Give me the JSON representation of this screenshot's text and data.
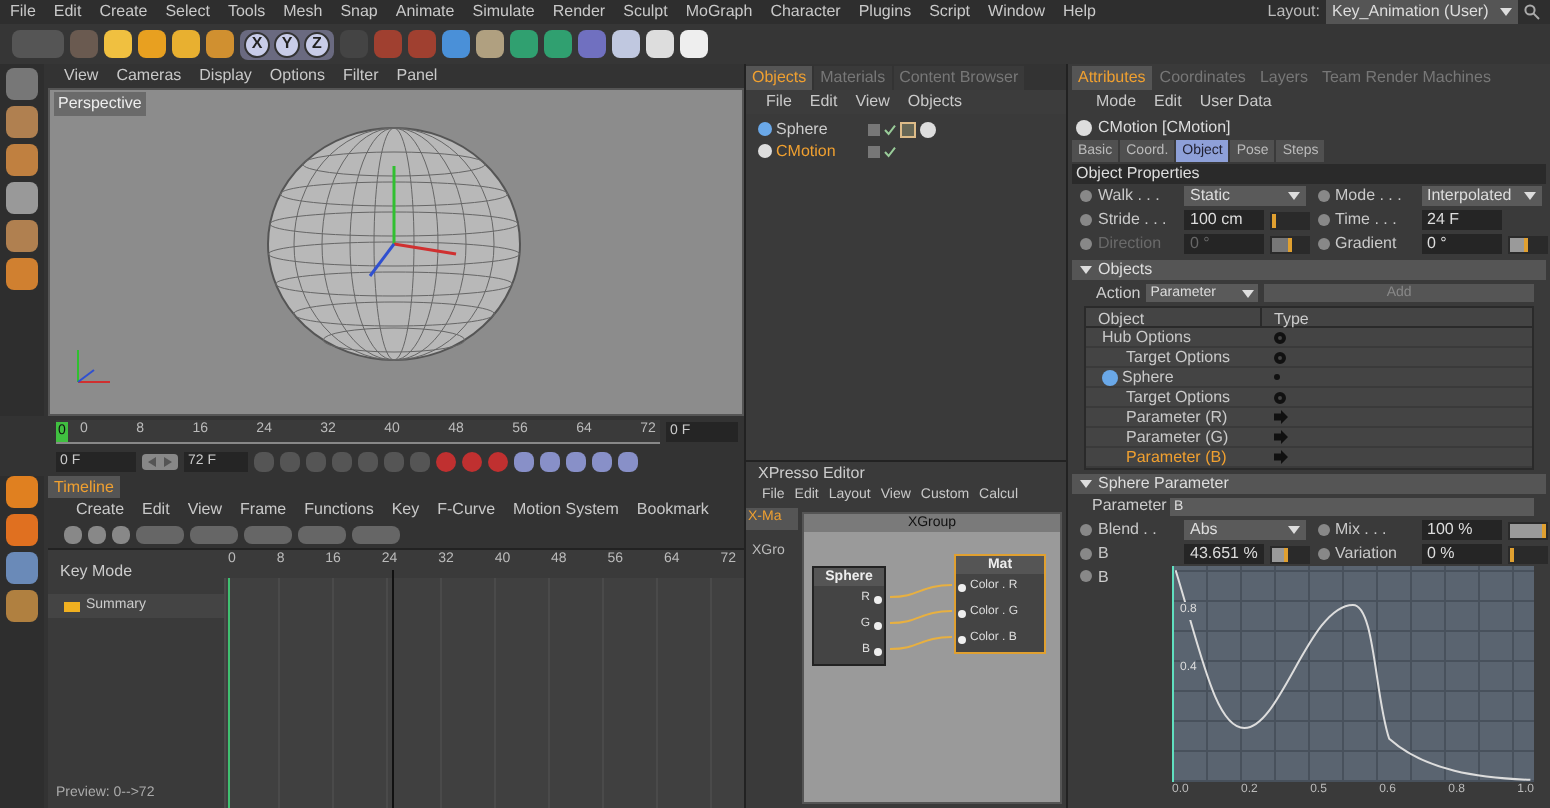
{
  "menu_bar": {
    "items": [
      "File",
      "Edit",
      "Create",
      "Select",
      "Tools",
      "Mesh",
      "Snap",
      "Animate",
      "Simulate",
      "Render",
      "Sculpt",
      "MoGraph",
      "Character",
      "Plugins",
      "Script",
      "Window",
      "Help"
    ],
    "layout_label": "Layout:",
    "layout_value": "Key_Animation (User)"
  },
  "toolbar": {
    "axis_buttons": [
      "X",
      "Y",
      "Z"
    ]
  },
  "viewport": {
    "menu": [
      "View",
      "Cameras",
      "Display",
      "Options",
      "Filter",
      "Panel"
    ],
    "camera_label": "Perspective"
  },
  "frame_ruler": {
    "ticks": [
      "0",
      "8",
      "16",
      "24",
      "32",
      "40",
      "48",
      "56",
      "64",
      "72"
    ],
    "playhead": "0",
    "current_frame": "0 F"
  },
  "transport": {
    "start": "0 F",
    "end": "72 F"
  },
  "timeline": {
    "tab": "Timeline",
    "menu": [
      "Create",
      "Edit",
      "View",
      "Frame",
      "Functions",
      "Key",
      "F-Curve",
      "Motion System",
      "Bookmark"
    ],
    "ticks": [
      "0",
      "8",
      "16",
      "24",
      "32",
      "40",
      "48",
      "56",
      "64",
      "72"
    ],
    "header": "Key Mode",
    "tracks": [
      {
        "name": "Summary",
        "selected": false
      }
    ],
    "status": "Preview: 0-->72"
  },
  "objects_panel": {
    "tabs": [
      {
        "label": "Objects",
        "selected": true
      },
      {
        "label": "Materials",
        "selected": false
      },
      {
        "label": "Content Browser",
        "selected": false
      }
    ],
    "menu": [
      "File",
      "Edit",
      "View",
      "Objects"
    ],
    "items": [
      {
        "name": "Sphere",
        "selected": false
      },
      {
        "name": "CMotion",
        "selected": true
      }
    ]
  },
  "xpresso": {
    "title": "XPresso Editor",
    "menu": [
      "File",
      "Edit",
      "Layout",
      "View",
      "Custom",
      "Calcul"
    ],
    "side_tab": "X-Ma",
    "tree_item": "XGro",
    "group": "XGroup",
    "nodes": [
      {
        "title": "Sphere",
        "ports": [
          "R",
          "G",
          "B"
        ]
      },
      {
        "title": "Mat",
        "ports": [
          "Color . R",
          "Color . G",
          "Color . B"
        ]
      }
    ]
  },
  "attributes": {
    "tabs": [
      {
        "label": "Attributes",
        "selected": true
      },
      {
        "label": "Coordinates",
        "selected": false
      },
      {
        "label": "Layers",
        "selected": false
      },
      {
        "label": "Team Render Machines",
        "selected": false
      }
    ],
    "menu": [
      "Mode",
      "Edit",
      "User Data"
    ],
    "title": "CMotion [CMotion]",
    "subtabs": [
      {
        "label": "Basic",
        "selected": false
      },
      {
        "label": "Coord.",
        "selected": false
      },
      {
        "label": "Object",
        "selected": true
      },
      {
        "label": "Pose",
        "selected": false
      },
      {
        "label": "Steps",
        "selected": false
      }
    ],
    "object_properties": {
      "title": "Object Properties",
      "fields": [
        {
          "label": "Walk . . .",
          "value": "Static",
          "kind": "dropdown",
          "disabled": false
        },
        {
          "label": "Mode . . .",
          "value": "Interpolated",
          "kind": "dropdown",
          "disabled": false
        },
        {
          "label": "Stride . . .",
          "value": "100 cm",
          "kind": "number",
          "level": 0.06,
          "disabled": false
        },
        {
          "label": "Time . . .",
          "value": "24 F",
          "kind": "number",
          "disabled": false
        },
        {
          "label": "Direction",
          "value": "0 °",
          "kind": "number",
          "level": 0.55,
          "disabled": true
        },
        {
          "label": "Gradient",
          "value": "0 °",
          "kind": "number",
          "level": 0.55,
          "disabled": false
        }
      ]
    },
    "objects": {
      "title": "Objects",
      "action_label": "Action",
      "action_value": "Parameter",
      "add_label": "Add",
      "columns": [
        "Object",
        "Type"
      ],
      "tree": [
        {
          "name": "Hub Options",
          "kind": "options",
          "selected": false,
          "children": [
            {
              "name": "Target Options",
              "kind": "options",
              "selected": false
            }
          ]
        },
        {
          "name": "Sphere",
          "kind": "object",
          "selected": false,
          "children": [
            {
              "name": "Target Options",
              "kind": "options",
              "selected": false
            },
            {
              "name": "Parameter (R)",
              "kind": "parameter",
              "selected": false
            },
            {
              "name": "Parameter (G)",
              "kind": "parameter",
              "selected": false
            },
            {
              "name": "Parameter (B)",
              "kind": "parameter",
              "selected": true
            }
          ]
        }
      ]
    },
    "sphere_parameter": {
      "title": "Sphere Parameter",
      "parameter_label": "Parameter",
      "parameter_value": "B",
      "fields": [
        {
          "label": "Blend . .",
          "value": "Abs",
          "kind": "dropdown"
        },
        {
          "label": "Mix . . .",
          "value": "100 %",
          "kind": "number",
          "level": 1
        },
        {
          "label": "B",
          "value": "43.651 %",
          "kind": "number",
          "level": 0.44
        },
        {
          "label": "Variation",
          "value": "0 %",
          "kind": "number",
          "level": 0
        }
      ],
      "spline_label": "B",
      "spline_x_labels": [
        "0.0",
        "0.2",
        "0.5",
        "0.6",
        "0.8",
        "1.0"
      ],
      "spline_y_labels": [
        "0.8",
        "0.4"
      ]
    }
  }
}
